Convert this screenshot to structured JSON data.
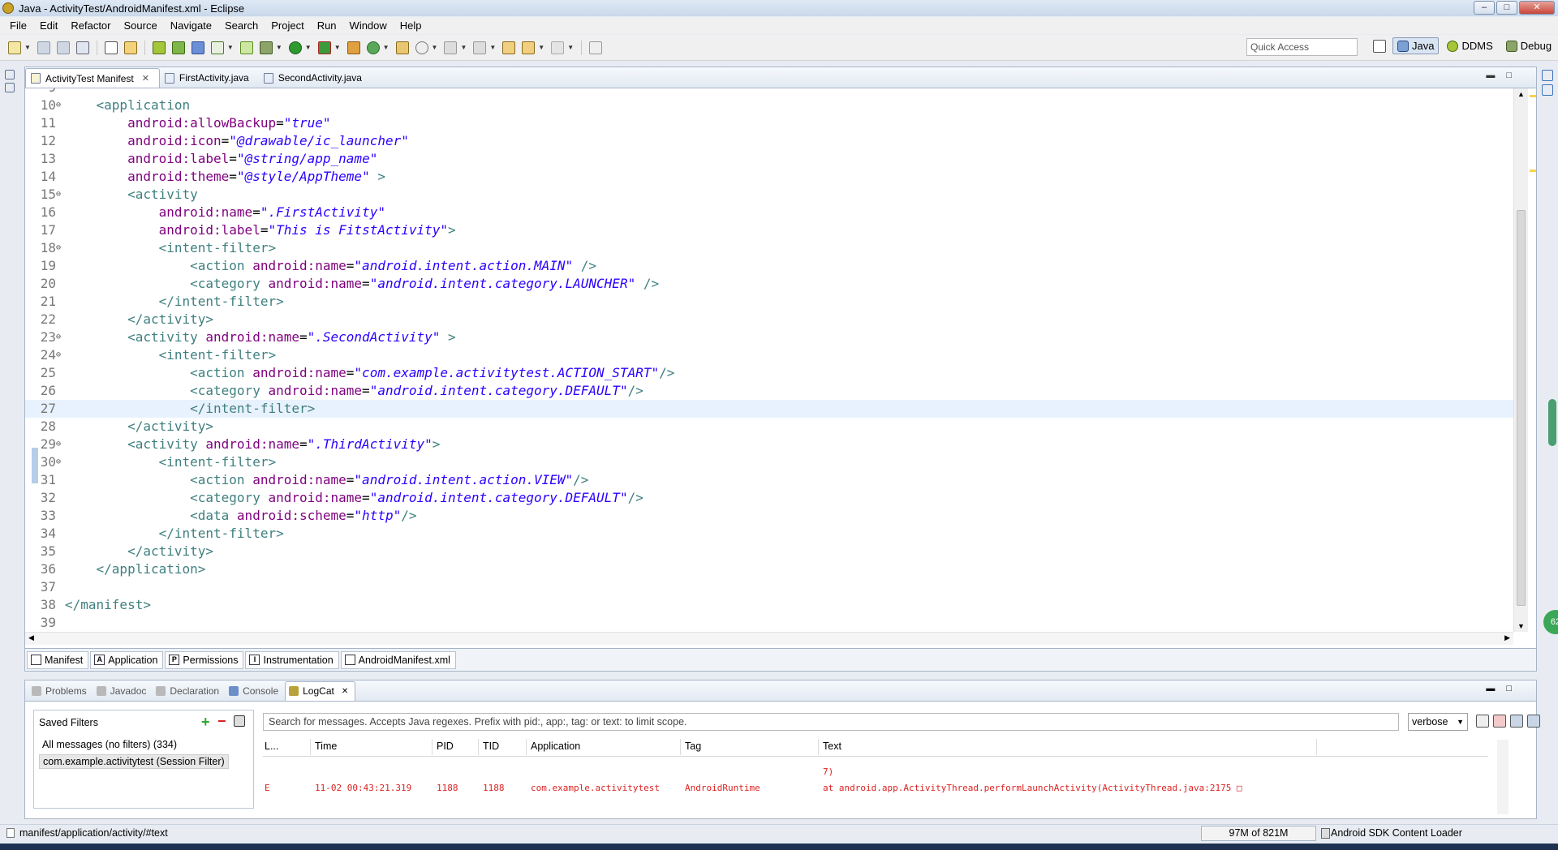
{
  "window": {
    "title": "Java - ActivityTest/AndroidManifest.xml - Eclipse"
  },
  "menu": [
    "File",
    "Edit",
    "Refactor",
    "Source",
    "Navigate",
    "Search",
    "Project",
    "Run",
    "Window",
    "Help"
  ],
  "toolbar": {
    "quick_access_placeholder": "Quick Access",
    "perspectives": [
      {
        "label": "Java",
        "icon": "java-perspective-icon",
        "active": true
      },
      {
        "label": "DDMS",
        "icon": "ddms-perspective-icon",
        "active": false
      },
      {
        "label": "Debug",
        "icon": "debug-perspective-icon",
        "active": false
      }
    ]
  },
  "editor": {
    "tabs": [
      {
        "label": "ActivityTest Manifest",
        "active": true,
        "closable": true
      },
      {
        "label": "FirstActivity.java",
        "active": false
      },
      {
        "label": "SecondActivity.java",
        "active": false
      }
    ],
    "current_line": 27,
    "lines": [
      {
        "n": "9",
        "tokens": []
      },
      {
        "n": "10",
        "fold": "⊖",
        "tokens": [
          [
            "tag",
            "    <application"
          ]
        ]
      },
      {
        "n": "11",
        "tokens": [
          [
            "attr",
            "        android:allowBackup"
          ],
          [
            "punc",
            "="
          ],
          [
            "val",
            "\"true\""
          ]
        ]
      },
      {
        "n": "12",
        "tokens": [
          [
            "attr",
            "        android:icon"
          ],
          [
            "punc",
            "="
          ],
          [
            "val",
            "\"@drawable/ic_launcher\""
          ]
        ]
      },
      {
        "n": "13",
        "tokens": [
          [
            "attr",
            "        android:label"
          ],
          [
            "punc",
            "="
          ],
          [
            "val",
            "\"@string/app_name\""
          ]
        ]
      },
      {
        "n": "14",
        "tokens": [
          [
            "attr",
            "        android:theme"
          ],
          [
            "punc",
            "="
          ],
          [
            "val",
            "\"@style/AppTheme\""
          ],
          [
            "tag",
            " >"
          ]
        ]
      },
      {
        "n": "15",
        "fold": "⊖",
        "tokens": [
          [
            "tag",
            "        <activity"
          ]
        ]
      },
      {
        "n": "16",
        "tokens": [
          [
            "attr",
            "            android:name"
          ],
          [
            "punc",
            "="
          ],
          [
            "val",
            "\".FirstActivity\""
          ]
        ]
      },
      {
        "n": "17",
        "tokens": [
          [
            "attr",
            "            android:label"
          ],
          [
            "punc",
            "="
          ],
          [
            "val",
            "\"This is FitstActivity\""
          ],
          [
            "tag",
            ">"
          ]
        ]
      },
      {
        "n": "18",
        "fold": "⊖",
        "tokens": [
          [
            "tag",
            "            <intent-filter>"
          ]
        ]
      },
      {
        "n": "19",
        "tokens": [
          [
            "tag",
            "                <action "
          ],
          [
            "attr",
            "android:name"
          ],
          [
            "punc",
            "="
          ],
          [
            "val",
            "\"android.intent.action.MAIN\""
          ],
          [
            "tag",
            " />"
          ]
        ]
      },
      {
        "n": "20",
        "tokens": [
          [
            "tag",
            "                <category "
          ],
          [
            "attr",
            "android:name"
          ],
          [
            "punc",
            "="
          ],
          [
            "val",
            "\"android.intent.category.LAUNCHER\""
          ],
          [
            "tag",
            " />"
          ]
        ]
      },
      {
        "n": "21",
        "tokens": [
          [
            "tag",
            "            </intent-filter>"
          ]
        ]
      },
      {
        "n": "22",
        "tokens": [
          [
            "tag",
            "        </activity>"
          ]
        ]
      },
      {
        "n": "23",
        "fold": "⊖",
        "tokens": [
          [
            "tag",
            "        <activity "
          ],
          [
            "attr",
            "android:name"
          ],
          [
            "punc",
            "="
          ],
          [
            "val",
            "\".SecondActivity\""
          ],
          [
            "tag",
            " >"
          ]
        ]
      },
      {
        "n": "24",
        "fold": "⊖",
        "tokens": [
          [
            "tag",
            "            <intent-filter>"
          ]
        ]
      },
      {
        "n": "25",
        "tokens": [
          [
            "tag",
            "                <action "
          ],
          [
            "attr",
            "android:name"
          ],
          [
            "punc",
            "="
          ],
          [
            "val",
            "\"com.example.activitytest.ACTION_START\""
          ],
          [
            "tag",
            "/>"
          ]
        ]
      },
      {
        "n": "26",
        "tokens": [
          [
            "tag",
            "                <category "
          ],
          [
            "attr",
            "android:name"
          ],
          [
            "punc",
            "="
          ],
          [
            "val",
            "\"android.intent.category.DEFAULT\""
          ],
          [
            "tag",
            "/>"
          ]
        ]
      },
      {
        "n": "27",
        "tokens": [
          [
            "tag",
            "                </intent-filter>"
          ]
        ]
      },
      {
        "n": "28",
        "tokens": [
          [
            "tag",
            "        </activity>"
          ]
        ]
      },
      {
        "n": "29",
        "fold": "⊖",
        "tokens": [
          [
            "tag",
            "        <activity "
          ],
          [
            "attr",
            "android:name"
          ],
          [
            "punc",
            "="
          ],
          [
            "val",
            "\".ThirdActivity\""
          ],
          [
            "tag",
            ">"
          ]
        ]
      },
      {
        "n": "30",
        "fold": "⊖",
        "tokens": [
          [
            "tag",
            "            <intent-filter>"
          ]
        ]
      },
      {
        "n": "31",
        "tokens": [
          [
            "tag",
            "                <action "
          ],
          [
            "attr",
            "android:name"
          ],
          [
            "punc",
            "="
          ],
          [
            "val",
            "\"android.intent.action.VIEW\""
          ],
          [
            "tag",
            "/>"
          ]
        ]
      },
      {
        "n": "32",
        "tokens": [
          [
            "tag",
            "                <category "
          ],
          [
            "attr",
            "android:name"
          ],
          [
            "punc",
            "="
          ],
          [
            "val",
            "\"android.intent.category.DEFAULT\""
          ],
          [
            "tag",
            "/>"
          ]
        ]
      },
      {
        "n": "33",
        "tokens": [
          [
            "tag",
            "                <data "
          ],
          [
            "attr",
            "android:scheme"
          ],
          [
            "punc",
            "="
          ],
          [
            "val",
            "\"http\""
          ],
          [
            "tag",
            "/>"
          ]
        ]
      },
      {
        "n": "34",
        "tokens": [
          [
            "tag",
            "            </intent-filter>"
          ]
        ]
      },
      {
        "n": "35",
        "tokens": [
          [
            "tag",
            "        </activity>"
          ]
        ]
      },
      {
        "n": "36",
        "tokens": [
          [
            "tag",
            "    </application>"
          ]
        ]
      },
      {
        "n": "37",
        "tokens": []
      },
      {
        "n": "38",
        "tokens": [
          [
            "tag",
            "</manifest>"
          ]
        ]
      },
      {
        "n": "39",
        "tokens": []
      }
    ],
    "bottom_tabs": [
      {
        "label": "Manifest",
        "badge": ""
      },
      {
        "label": "Application",
        "badge": "A"
      },
      {
        "label": "Permissions",
        "badge": "P"
      },
      {
        "label": "Instrumentation",
        "badge": "I"
      },
      {
        "label": "AndroidManifest.xml",
        "badge": ""
      }
    ]
  },
  "bottom_panel": {
    "tabs": [
      {
        "label": "Problems",
        "active": false,
        "icon": "problems-icon"
      },
      {
        "label": "Javadoc",
        "active": false,
        "icon": "javadoc-icon"
      },
      {
        "label": "Declaration",
        "active": false,
        "icon": "declaration-icon"
      },
      {
        "label": "Console",
        "active": false,
        "icon": "console-icon"
      },
      {
        "label": "LogCat",
        "active": true,
        "icon": "logcat-icon"
      }
    ],
    "saved_filters": {
      "title": "Saved Filters",
      "items": [
        {
          "label": "All messages (no filters) (334)",
          "selected": false
        },
        {
          "label": "com.example.activitytest (Session Filter)",
          "selected": true
        }
      ]
    },
    "search_placeholder": "Search for messages. Accepts Java regexes. Prefix with pid:, app:, tag: or text: to limit scope.",
    "log_level": "verbose",
    "columns": [
      "L...",
      "Time",
      "PID",
      "TID",
      "Application",
      "Tag",
      "Text"
    ],
    "rows": [
      {
        "level": "",
        "time": "",
        "pid": "",
        "tid": "",
        "app": "",
        "tag": "",
        "text": "7)"
      },
      {
        "level": "E",
        "time": "11-02 00:43:21.319",
        "pid": "1188",
        "tid": "1188",
        "app": "com.example.activitytest",
        "tag": "AndroidRuntime",
        "text": "at android.app.ActivityThread.performLaunchActivity(ActivityThread.java:2175 □"
      }
    ]
  },
  "status": {
    "path": "manifest/application/activity/#text",
    "heap": "97M of 821M",
    "job": "Android SDK Content Loader"
  },
  "colors": {
    "tag": "#3f7f7f",
    "attr": "#7f007f",
    "value": "#2a00ff",
    "error": "#dd2222",
    "current_line": "#e8f2fe"
  }
}
